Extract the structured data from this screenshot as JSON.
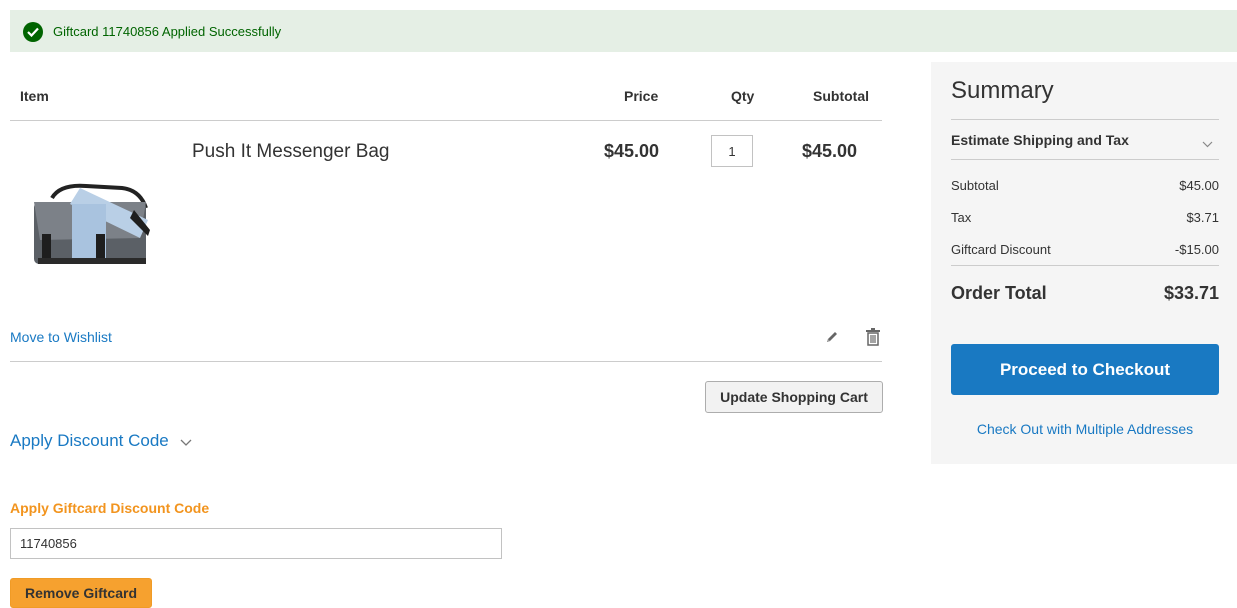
{
  "message": {
    "text": "Giftcard 11740856 Applied Successfully",
    "icon": "check-circle-icon",
    "color": "#006400",
    "background": "#e5efe5"
  },
  "cart": {
    "headers": {
      "item": "Item",
      "price": "Price",
      "qty": "Qty",
      "subtotal": "Subtotal"
    },
    "items": [
      {
        "name": "Push It Messenger Bag",
        "price": "$45.00",
        "qty": "1",
        "subtotal": "$45.00",
        "image": "messenger-bag-image"
      }
    ],
    "move_to_wishlist": "Move to Wishlist",
    "edit_icon": "pencil-icon",
    "delete_icon": "trash-icon",
    "update_button": "Update Shopping Cart"
  },
  "discount": {
    "toggle_label": "Apply Discount Code"
  },
  "giftcard": {
    "title": "Apply Giftcard Discount Code",
    "code_value": "11740856",
    "remove_button": "Remove Giftcard"
  },
  "summary": {
    "title": "Summary",
    "estimate_label": "Estimate Shipping and Tax",
    "rows": [
      {
        "label": "Subtotal",
        "value": "$45.00"
      },
      {
        "label": "Tax",
        "value": "$3.71"
      },
      {
        "label": "Giftcard Discount",
        "value": "-$15.00"
      }
    ],
    "total_label": "Order Total",
    "total_value": "$33.71",
    "checkout_button": "Proceed to Checkout",
    "multi_address_link": "Check Out with Multiple Addresses"
  },
  "colors": {
    "link": "#1979c3",
    "primary_button": "#1979c2",
    "giftcard_accent": "#f2941e",
    "remove_button": "#f6a12f"
  }
}
